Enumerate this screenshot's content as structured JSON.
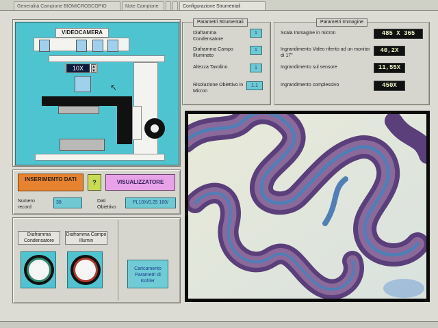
{
  "tabs": [
    {
      "label": "Generalità Campione BIOMICROSCOPIO"
    },
    {
      "label": "Note Campione"
    },
    {
      "label": "Configurazione Strumentali"
    }
  ],
  "scope": {
    "title": "VIDEOCAMERA",
    "objective_zoom": "10X"
  },
  "strumentali": {
    "title": "Parametri Strumentali",
    "rows": [
      {
        "label": "Diaframma Condensatore",
        "value": "1"
      },
      {
        "label": "Diaframma Campo Illuminato",
        "value": "1"
      },
      {
        "label": "Altezza Tavolino",
        "value": "1"
      },
      {
        "label": "Risoluzione Obiettivo in Micron",
        "value": "1.1"
      }
    ]
  },
  "immagine": {
    "title": "Parametri Immagine",
    "rows": [
      {
        "label": "Scala Immagine in micron",
        "value": "485 X 365"
      },
      {
        "label": "Ingrandimento Video riferito ad un monitor di 17\"",
        "value": "40,2X"
      },
      {
        "label": "Ingrandimento sul sensore",
        "value": "11,55X"
      },
      {
        "label": "Ingrandimento complessivo",
        "value": "450X"
      }
    ]
  },
  "actions": {
    "inserimento": "INSERIMENTO DATI",
    "help": "?",
    "visualizzatore": "VISUALIZZATORE",
    "numero_label": "Numero record",
    "numero_value": "38",
    "dati_label": "Dati Obiettivo",
    "dati_value": "PL10X/0.25 160/"
  },
  "diaframmi": {
    "condensatore": "Diaframma Condensatore",
    "campo": "Diaframma Campo Illumin",
    "caricamento": "Caricamento Parametri di Kohler"
  },
  "colors": {
    "scope_bg": "#4ec4d0",
    "orange": "#e7832e",
    "pink": "#e8a2e8",
    "green": "#c9da54"
  }
}
